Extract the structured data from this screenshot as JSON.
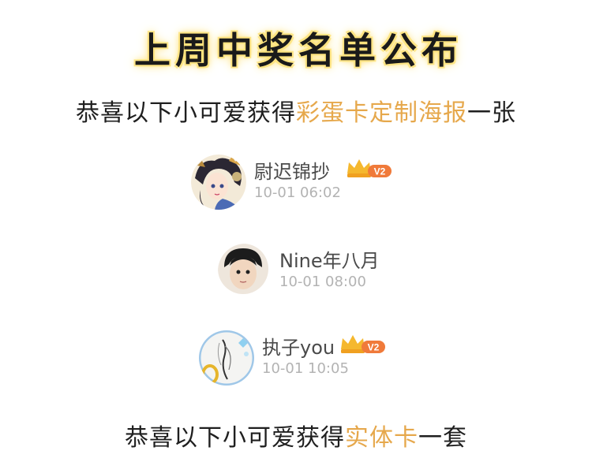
{
  "header": {
    "title": "上周中奖名单公布"
  },
  "prize1": {
    "prefix": "恭喜以下小可爱获得",
    "highlight": "彩蛋卡定制海报",
    "suffix": "一张"
  },
  "winners": [
    {
      "name": "尉迟锦抄",
      "time": "10-01 06:02",
      "vip_label": "V2"
    },
    {
      "name": "Nine年八月",
      "time": "10-01 08:00"
    },
    {
      "name": "执子you",
      "time": "10-01 10:05",
      "vip_label": "V2"
    }
  ],
  "prize2": {
    "prefix": "恭喜以下小可爱获得",
    "highlight": "实体卡",
    "suffix": "一套"
  },
  "colors": {
    "highlight": "#e6a84c",
    "title_glow": "#ffe27a",
    "vip_badge": "#f07a3a",
    "crown": "#f5b82e"
  },
  "icons": {
    "crown": "crown-icon",
    "vip": "vip-badge-icon"
  }
}
